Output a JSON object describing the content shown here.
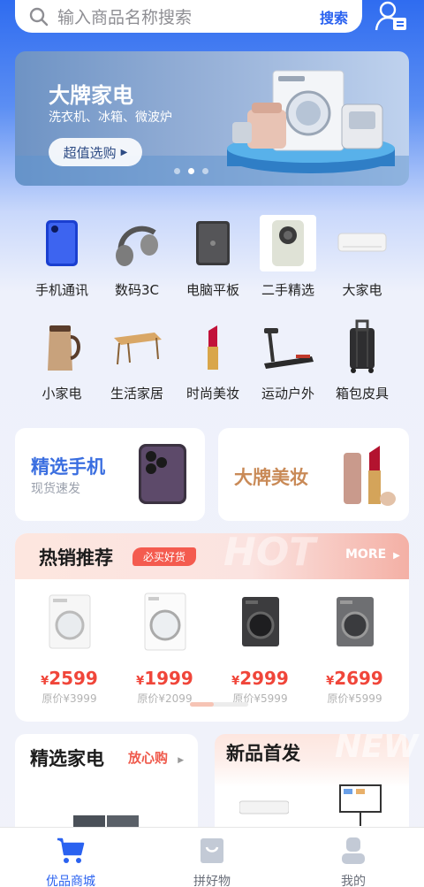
{
  "search": {
    "placeholder": "输入商品名称搜索",
    "button": "搜索"
  },
  "banner": {
    "title": "大牌家电",
    "subtitle": "洗衣机、冰箱、微波炉",
    "cta": "超值选购"
  },
  "categories": [
    {
      "label": "手机通讯",
      "icon": "phone-icon"
    },
    {
      "label": "数码3C",
      "icon": "headphones-icon"
    },
    {
      "label": "电脑平板",
      "icon": "tablet-icon"
    },
    {
      "label": "二手精选",
      "icon": "used-phone-icon"
    },
    {
      "label": "大家电",
      "icon": "air-conditioner-icon"
    },
    {
      "label": "小家电",
      "icon": "kettle-icon"
    },
    {
      "label": "生活家居",
      "icon": "table-icon"
    },
    {
      "label": "时尚美妆",
      "icon": "lipstick-icon"
    },
    {
      "label": "运动户外",
      "icon": "treadmill-icon"
    },
    {
      "label": "箱包皮具",
      "icon": "suitcase-icon"
    }
  ],
  "promos": {
    "phone": {
      "title": "精选手机",
      "subtitle": "现货速发"
    },
    "beauty": {
      "title": "大牌美妆"
    }
  },
  "hot": {
    "title": "热销推荐",
    "tag": "必买好货",
    "watermark": "HOT",
    "more": "MORE",
    "products": [
      {
        "price": "2599",
        "original": "原价¥3999",
        "color": "white"
      },
      {
        "price": "1999",
        "original": "原价¥2099",
        "color": "white"
      },
      {
        "price": "2999",
        "original": "原价¥5999",
        "color": "dark"
      },
      {
        "price": "2699",
        "original": "原价¥5999",
        "color": "gray"
      }
    ]
  },
  "appliances": {
    "title": "精选家电",
    "link": "放心购"
  },
  "newArrivals": {
    "title": "新品首发",
    "watermark": "NEW"
  },
  "tabs": [
    {
      "label": "优品商城",
      "active": true
    },
    {
      "label": "拼好物",
      "active": false
    },
    {
      "label": "我的",
      "active": false
    }
  ],
  "colors": {
    "accent": "#2a62f0",
    "price": "#f0463a",
    "hotTag": "#f45b4f"
  }
}
